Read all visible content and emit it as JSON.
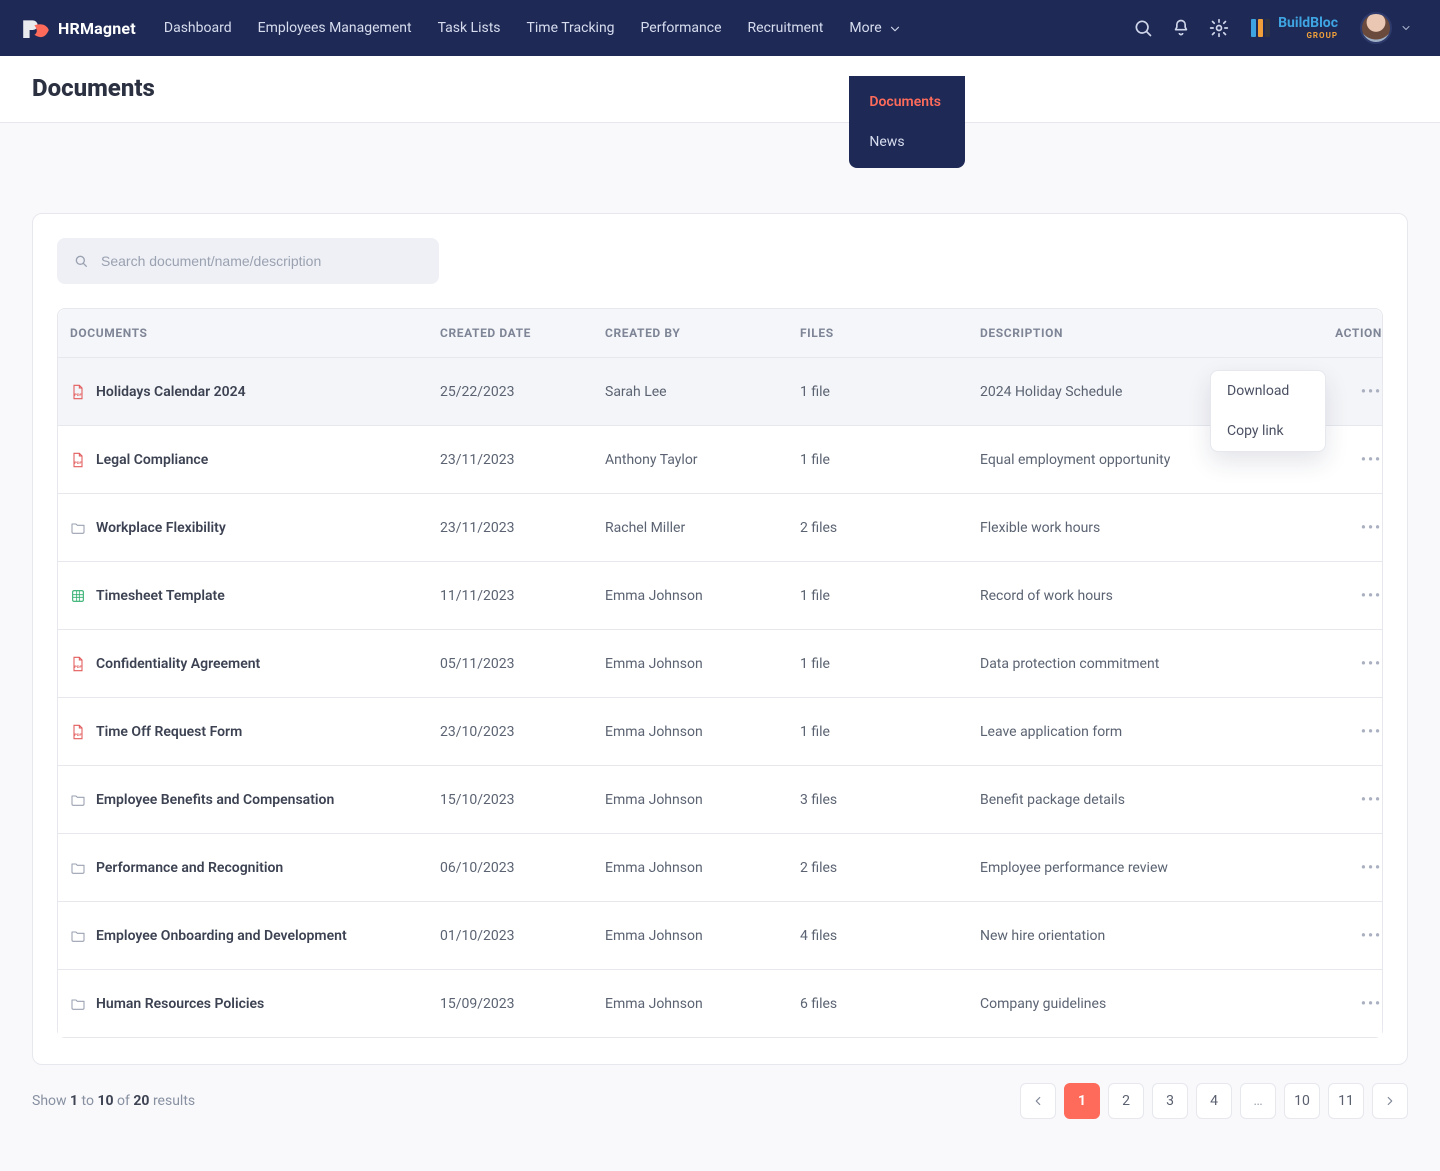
{
  "brand": {
    "name": "HRMagnet"
  },
  "nav": {
    "items": [
      {
        "label": "Dashboard"
      },
      {
        "label": "Employees Management"
      },
      {
        "label": "Task Lists"
      },
      {
        "label": "Time Tracking"
      },
      {
        "label": "Performance"
      },
      {
        "label": "Recruitment"
      }
    ],
    "more_label": "More",
    "more_menu": [
      {
        "label": "Documents",
        "active": true
      },
      {
        "label": "News",
        "active": false
      }
    ]
  },
  "company": {
    "word1": "BuildBloc",
    "word2": "GROUP"
  },
  "page": {
    "title": "Documents"
  },
  "search": {
    "placeholder": "Search document/name/description"
  },
  "columns": {
    "documents": "DOCUMENTS",
    "created_date": "CREATED DATE",
    "created_by": "CREATED BY",
    "files": "FILES",
    "description": "DESCRIPTION",
    "action": "ACTION"
  },
  "action_popover": {
    "download": "Download",
    "copy": "Copy link"
  },
  "rows": [
    {
      "icon": "pdf",
      "name": "Holidays Calendar 2024",
      "date": "25/22/2023",
      "by": "Sarah Lee",
      "files": "1 file",
      "desc": "2024 Holiday Schedule"
    },
    {
      "icon": "pdf",
      "name": "Legal Compliance",
      "date": "23/11/2023",
      "by": "Anthony Taylor",
      "files": "1 file",
      "desc": "Equal employment opportunity"
    },
    {
      "icon": "folder",
      "name": "Workplace Flexibility",
      "date": "23/11/2023",
      "by": "Rachel Miller",
      "files": "2 files",
      "desc": "Flexible work hours"
    },
    {
      "icon": "xls",
      "name": "Timesheet Template",
      "date": "11/11/2023",
      "by": "Emma Johnson",
      "files": "1 file",
      "desc": "Record of work hours"
    },
    {
      "icon": "pdf",
      "name": "Confidentiality Agreement",
      "date": "05/11/2023",
      "by": "Emma Johnson",
      "files": "1 file",
      "desc": "Data protection commitment"
    },
    {
      "icon": "pdf",
      "name": "Time Off Request Form",
      "date": "23/10/2023",
      "by": "Emma Johnson",
      "files": "1 file",
      "desc": "Leave application form"
    },
    {
      "icon": "folder",
      "name": "Employee Benefits and Compensation",
      "date": "15/10/2023",
      "by": "Emma Johnson",
      "files": "3 files",
      "desc": "Benefit package details"
    },
    {
      "icon": "folder",
      "name": "Performance and Recognition",
      "date": "06/10/2023",
      "by": "Emma Johnson",
      "files": "2 files",
      "desc": "Employee performance review"
    },
    {
      "icon": "folder",
      "name": "Employee Onboarding and Development",
      "date": "01/10/2023",
      "by": "Emma Johnson",
      "files": "4 files",
      "desc": "New hire orientation"
    },
    {
      "icon": "folder",
      "name": "Human Resources Policies",
      "date": "15/09/2023",
      "by": "Emma Johnson",
      "files": "6 files",
      "desc": "Company guidelines"
    }
  ],
  "pagination": {
    "show_word": "Show",
    "from": "1",
    "to_word": "to",
    "to": "10",
    "of_word": "of",
    "total": "20",
    "results_word": "results",
    "pages": [
      "1",
      "2",
      "3",
      "4",
      "…",
      "10",
      "11"
    ],
    "active_index": 0
  }
}
